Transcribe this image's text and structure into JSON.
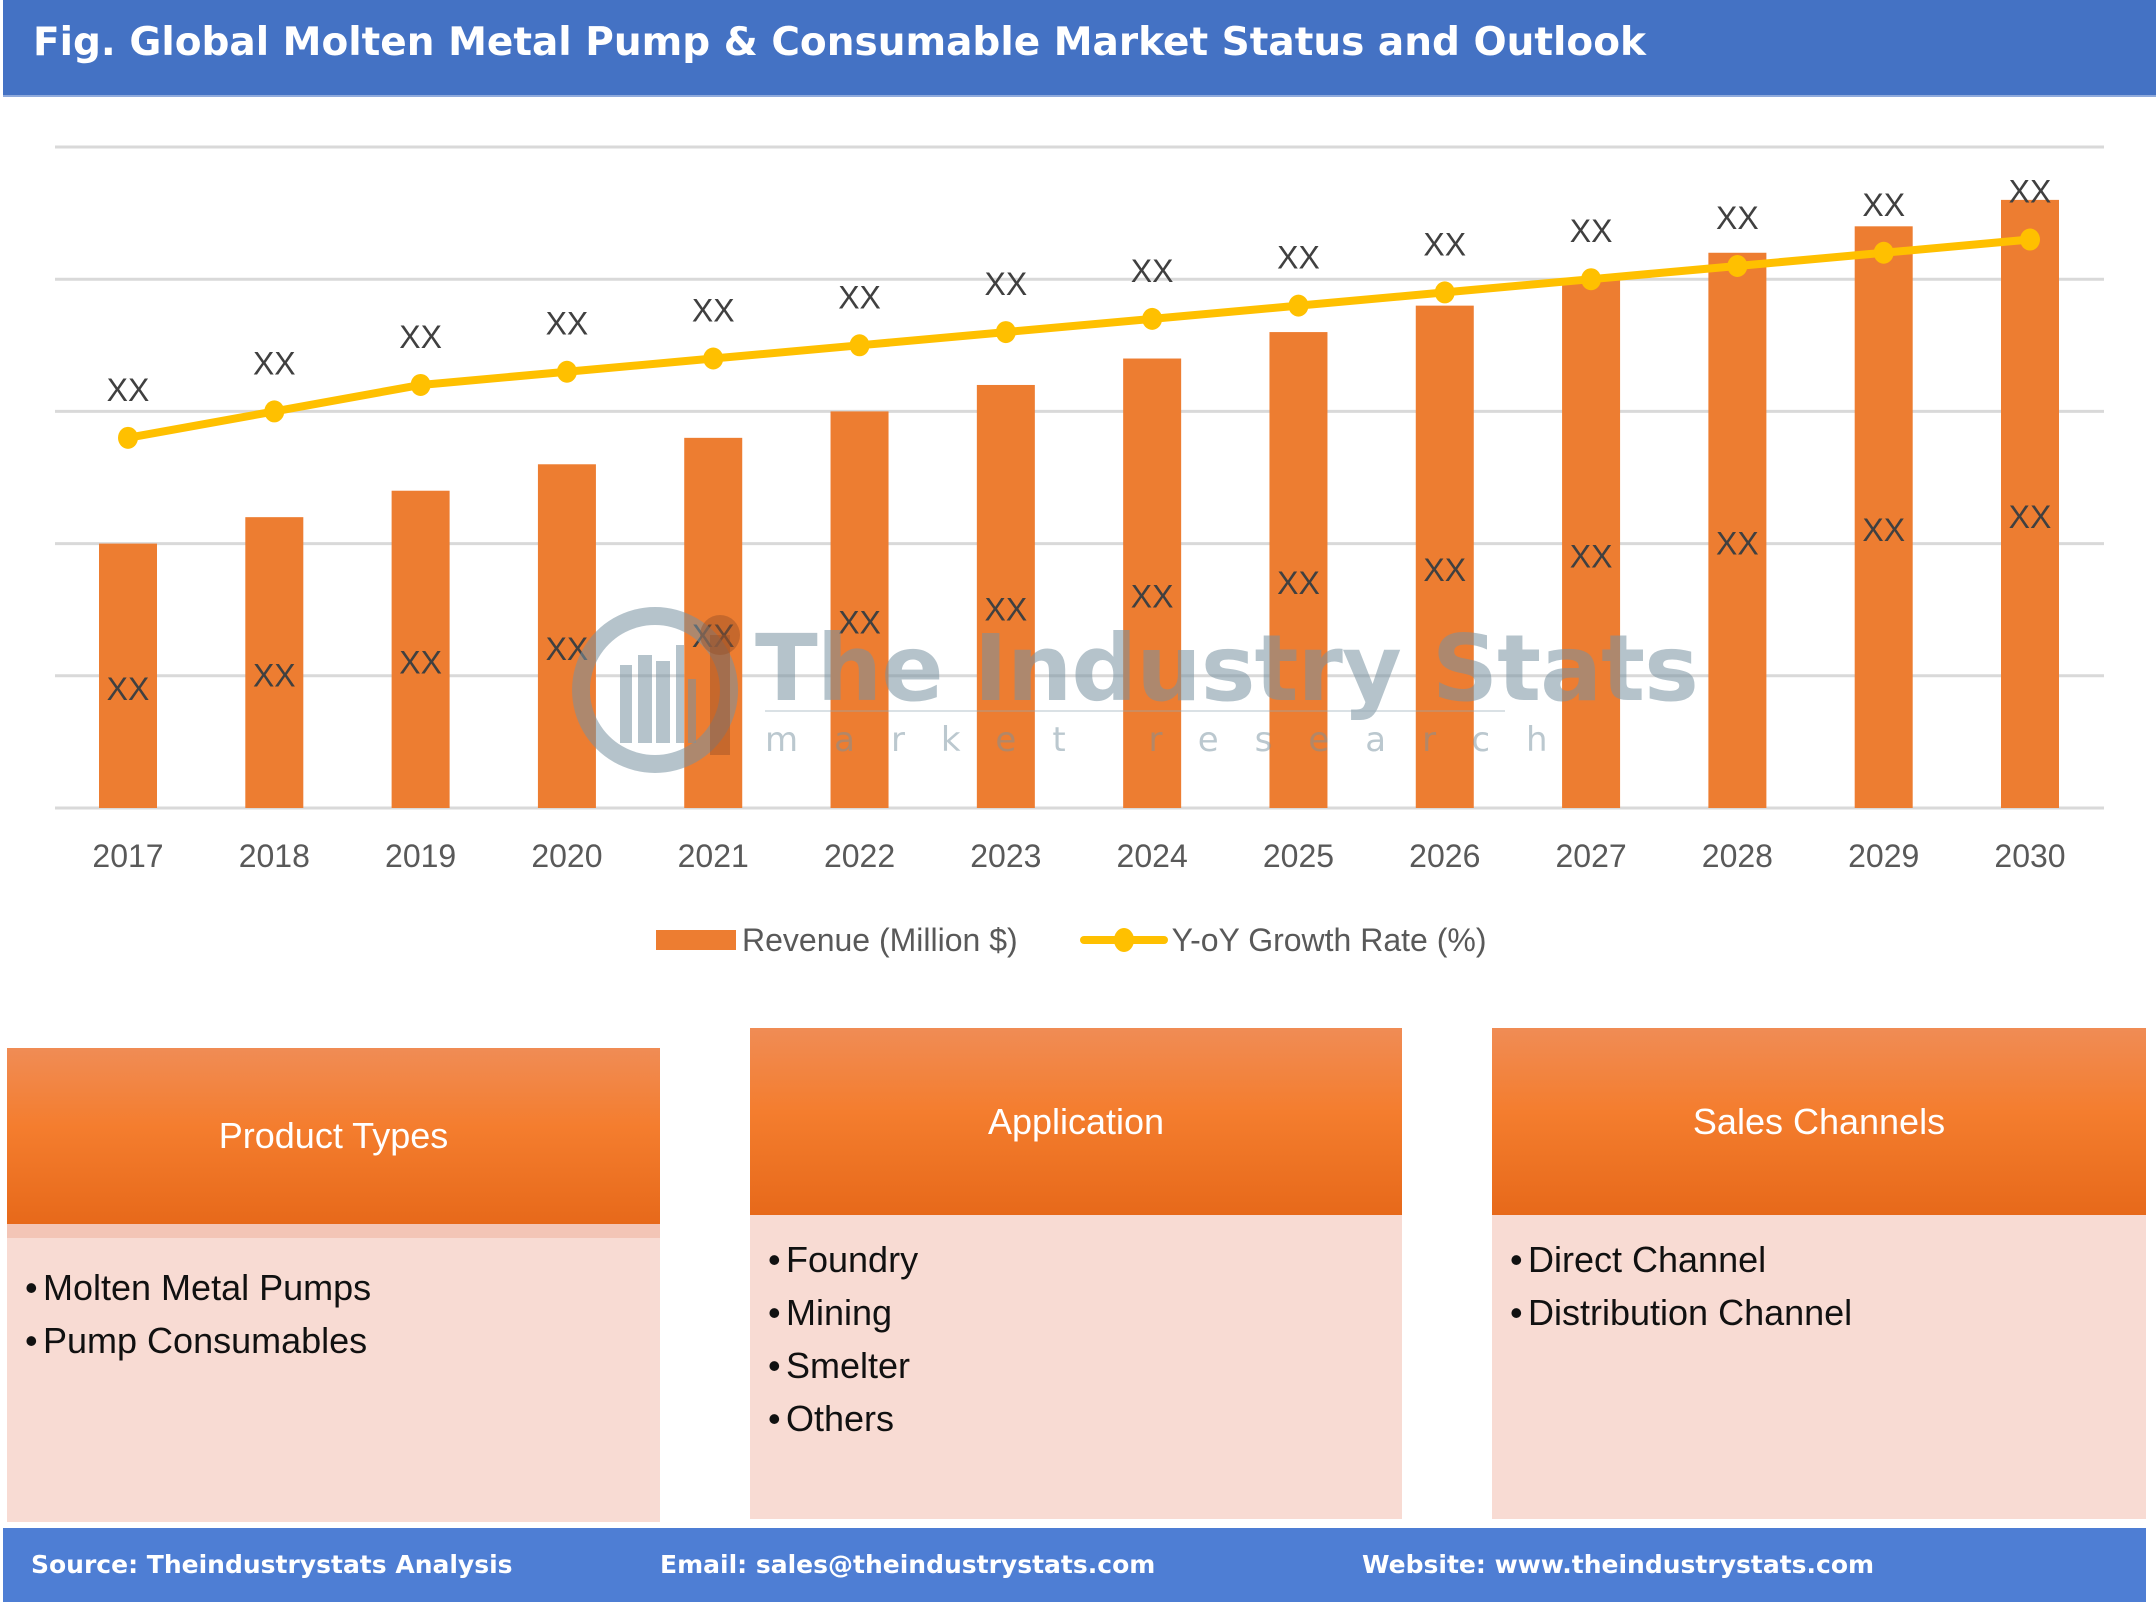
{
  "header": {
    "title": "Fig. Global Molten Metal Pump & Consumable Market Status and Outlook"
  },
  "chart_data": {
    "type": "bar",
    "title": "Fig. Global Molten Metal Pump & Consumable Market Status and Outlook",
    "xlabel": "",
    "ylabel": "",
    "y_axis_note": "Axes unlabeled; values are relative gridline units (0–5), read from gridlines",
    "ylim": [
      0,
      5
    ],
    "grid": true,
    "legend_position": "bottom",
    "categories": [
      "2017",
      "2018",
      "2019",
      "2020",
      "2021",
      "2022",
      "2023",
      "2024",
      "2025",
      "2026",
      "2027",
      "2028",
      "2029",
      "2030"
    ],
    "series": [
      {
        "name": "Revenue (Million $)",
        "type": "bar",
        "color": "#ED7D31",
        "values": [
          2.0,
          2.2,
          2.4,
          2.6,
          2.8,
          3.0,
          3.2,
          3.4,
          3.6,
          3.8,
          4.0,
          4.2,
          4.4,
          4.6
        ],
        "data_labels": [
          "XX",
          "XX",
          "XX",
          "XX",
          "XX",
          "XX",
          "XX",
          "XX",
          "XX",
          "XX",
          "XX",
          "XX",
          "XX",
          "XX"
        ]
      },
      {
        "name": "Y-oY Growth Rate (%)",
        "type": "line",
        "color": "#FFC000",
        "values": [
          2.8,
          3.0,
          3.2,
          3.3,
          3.4,
          3.5,
          3.6,
          3.7,
          3.8,
          3.9,
          4.0,
          4.1,
          4.2,
          4.3
        ],
        "data_labels": [
          "XX",
          "XX",
          "XX",
          "XX",
          "XX",
          "XX",
          "XX",
          "XX",
          "XX",
          "XX",
          "XX",
          "XX",
          "XX",
          "XX"
        ]
      }
    ]
  },
  "legend": {
    "bar_label": "Revenue (Million $)",
    "line_label": "Y-oY Growth Rate (%)"
  },
  "watermark": {
    "brand": "The Industry Stats",
    "tagline": "market research"
  },
  "segments": [
    {
      "title": "Product Types",
      "items": [
        "Molten Metal Pumps",
        "Pump Consumables"
      ]
    },
    {
      "title": "Application",
      "items": [
        "Foundry",
        "Mining",
        "Smelter",
        "Others"
      ]
    },
    {
      "title": "Sales Channels",
      "items": [
        "Direct Channel",
        "Distribution Channel"
      ]
    }
  ],
  "bullet": "•",
  "footer": {
    "source": "Source: Theindustrystats Analysis",
    "email": "Email: sales@theindustrystats.com",
    "website": "Website: www.theindustrystats.com"
  },
  "colors": {
    "title_bar": "#4472C4",
    "footer": "#4E7ED4",
    "bar": "#ED7D31",
    "line": "#FFC000",
    "segment_body": "#F8DBD3"
  }
}
